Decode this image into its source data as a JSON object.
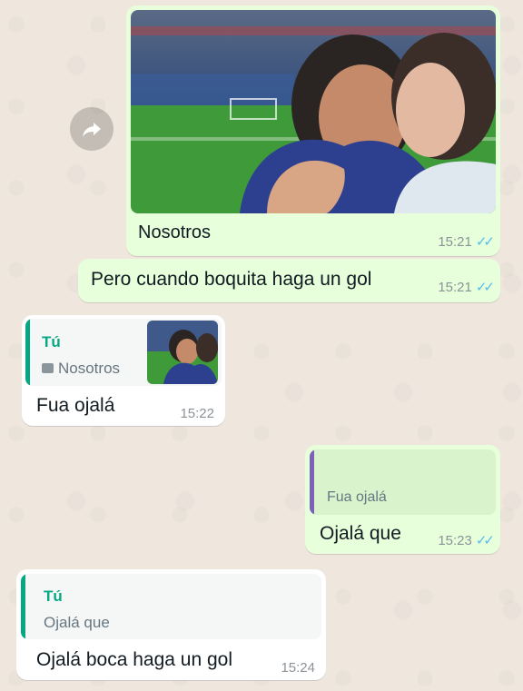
{
  "messages": [
    {
      "id": "m1",
      "caption": "Nosotros",
      "time": "15:21",
      "ticks": "✓✓"
    },
    {
      "id": "m2",
      "text": "Pero cuando boquita haga un gol",
      "time": "15:21",
      "ticks": "✓✓"
    },
    {
      "id": "m3",
      "quote_author": "Tú",
      "quote_text": "Nosotros",
      "quote_icon": "photo-icon",
      "text": "Fua ojalá",
      "time": "15:22"
    },
    {
      "id": "m4",
      "quote_text": "Fua ojalá",
      "text": "Ojalá que",
      "time": "15:23",
      "ticks": "✓✓"
    },
    {
      "id": "m5",
      "quote_author": "Tú",
      "quote_text": "Ojalá que",
      "text": "Ojalá boca haga un gol",
      "time": "15:24"
    }
  ],
  "colors": {
    "outgoing_bubble": "#e7ffdb",
    "incoming_bubble": "#ffffff",
    "read_ticks": "#53bdeb",
    "quote_author": "#06a884",
    "quote_bar_outgoing": "#7b61b8",
    "wallpaper": "#efe7de"
  },
  "icons": {
    "forward": "forward-arrow-icon",
    "image_placeholder": "photo-icon"
  }
}
